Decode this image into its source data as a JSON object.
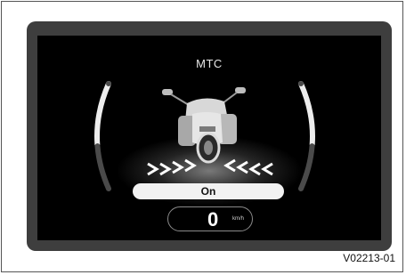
{
  "display": {
    "title": "MTC",
    "status": "On",
    "speed": {
      "value": "0",
      "unit": "km/h"
    }
  },
  "figure_code": "V02213-01",
  "icons": {
    "motorcycle": "motorcycle-rear-icon",
    "traction_chevrons": "chevron-arrows-icon"
  }
}
